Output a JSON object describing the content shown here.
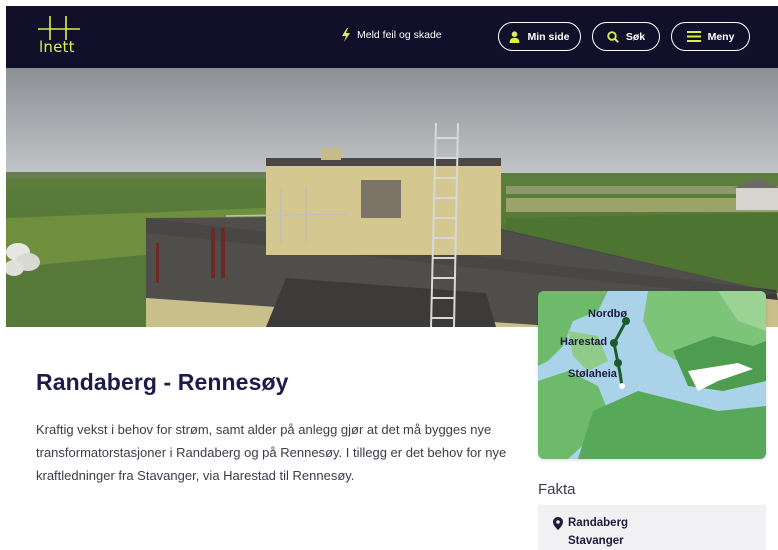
{
  "header": {
    "logo_text": "lnett",
    "report_link": "Meld feil og skade",
    "my_page_button": "Min side",
    "search_button": "Søk",
    "menu_button": "Meny"
  },
  "hero": {
    "alt": "Transformatorstasjon i jordbrukslandskap"
  },
  "main": {
    "title": "Randaberg - Rennesøy",
    "intro": "Kraftig vekst i behov for strøm, samt alder på anlegg gjør at det må bygges nye transformatorstasjoner i Randaberg og på Rennesøy. I tillegg er det behov for nye kraftledninger fra Stavanger, via Harestad til Rennesøy."
  },
  "map": {
    "labels": [
      "Nordbø",
      "Harestad",
      "Stølaheia"
    ]
  },
  "facts": {
    "heading": "Fakta",
    "location_line1": "Randaberg",
    "location_line2": "Stavanger"
  },
  "colors": {
    "header_bg": "#120f2a",
    "brand_lime": "#d9f14a",
    "title_navy": "#1d1b4b"
  }
}
